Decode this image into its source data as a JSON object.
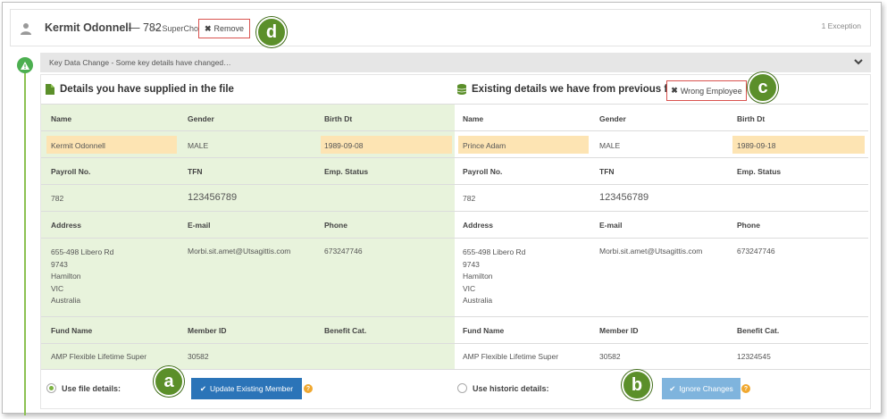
{
  "header": {
    "name": "Kermit Odonnell",
    "id_text": "— 782",
    "fund_text": "— SuperChoice",
    "remove_label": "Remove",
    "exception_text": "1 Exception"
  },
  "callouts": {
    "a": "a",
    "b": "b",
    "c": "c",
    "d": "d"
  },
  "key_change": {
    "text": "Key Data Change - Some key details have changed…"
  },
  "left": {
    "title": "Details you have supplied in the file",
    "labels": {
      "name": "Name",
      "gender": "Gender",
      "birth": "Birth Dt",
      "payroll": "Payroll No.",
      "tfn": "TFN",
      "status": "Emp. Status",
      "address": "Address",
      "email": "E-mail",
      "phone": "Phone",
      "fund": "Fund Name",
      "member": "Member ID",
      "benefit": "Benefit Cat."
    },
    "values": {
      "name": "Kermit Odonnell",
      "gender": "MALE",
      "birth": "1989-09-08",
      "payroll": "782",
      "tfn": "123456789",
      "status": "",
      "address": [
        "655-498 Libero Rd",
        "9743",
        "Hamilton",
        "VIC",
        "Australia"
      ],
      "email": "Morbi.sit.amet@Utsagittis.com",
      "phone": "673247746",
      "fund": "AMP Flexible Lifetime Super",
      "member": "30582",
      "benefit": ""
    },
    "option_label": "Use file details:",
    "button_label": "Update Existing Member"
  },
  "right": {
    "title": "Existing details we have from previous files",
    "wrong_label": "Wrong Employee",
    "labels": {
      "name": "Name",
      "gender": "Gender",
      "birth": "Birth Dt",
      "payroll": "Payroll No.",
      "tfn": "TFN",
      "status": "Emp. Status",
      "address": "Address",
      "email": "E-mail",
      "phone": "Phone",
      "fund": "Fund Name",
      "member": "Member ID",
      "benefit": "Benefit Cat."
    },
    "values": {
      "name": "Prince Adam",
      "gender": "MALE",
      "birth": "1989-09-18",
      "payroll": "782",
      "tfn": "123456789",
      "status": "",
      "address": [
        "655-498 Libero Rd",
        "9743",
        "Hamilton",
        "VIC",
        "Australia"
      ],
      "email": "Morbi.sit.amet@Utsagittis.com",
      "phone": "673247746",
      "fund": "AMP Flexible Lifetime Super",
      "member": "30582",
      "benefit": "12324545"
    },
    "option_label": "Use historic details:",
    "button_label": "Ignore Changes"
  },
  "colors": {
    "accent_green": "#5b8f2a",
    "panel_green": "#e8f3dc",
    "highlight": "#fde4b3",
    "primary_blue": "#2b74b8",
    "disabled_blue": "#7fb4dd",
    "danger_border": "#d9534f"
  },
  "icons": [
    "person-icon",
    "warning-icon",
    "file-icon",
    "database-icon",
    "close-icon",
    "check-icon",
    "help-icon",
    "chevron-down-icon"
  ]
}
